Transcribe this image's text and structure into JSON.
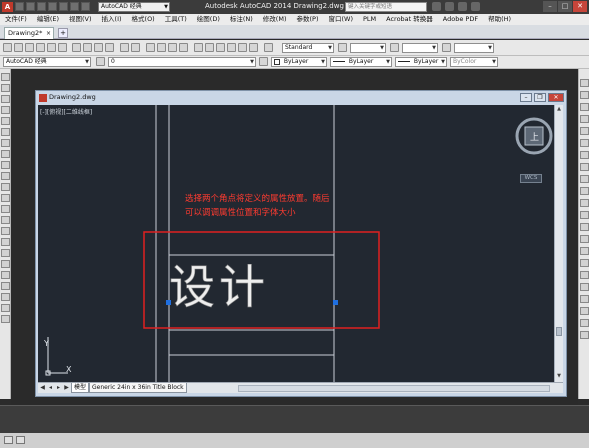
{
  "titlebar": {
    "app_title": "Autodesk AutoCAD 2014    Drawing2.dwg",
    "workspace_value": "AutoCAD 经典",
    "search_placeholder": "键入关键字或短语",
    "app_icon": "A"
  },
  "menubar": {
    "items": [
      "文件(F)",
      "编辑(E)",
      "视图(V)",
      "插入(I)",
      "格式(O)",
      "工具(T)",
      "绘图(D)",
      "标注(N)",
      "修改(M)",
      "参数(P)",
      "窗口(W)",
      "PLM",
      "Acrobat 转换器",
      "Adobe PDF",
      "帮助(H)"
    ]
  },
  "tabs": {
    "active_tab": "Drawing2*",
    "close_glyph": "×",
    "new_tab_glyph": "+"
  },
  "toolbar1": {
    "textstyle_value": "Standard"
  },
  "toolbar2": {
    "workspace_value": "AutoCAD 经典",
    "layer_value": "0",
    "color_value": "ByLayer",
    "linetype_value": "ByLayer",
    "lineweight_value": "ByLayer",
    "plotstyle_value": "ByColor"
  },
  "drawing_window": {
    "title": "Drawing2.dwg",
    "viewport_label": "[-][俯视][二维线框]",
    "wcs_label": "WCS",
    "viewcube_face": "上",
    "ucs_y": "Y",
    "ucs_x": "X"
  },
  "layout_tabs": {
    "model_tab": "模型",
    "layout_tab": "Generic 24in x 36in Title Block"
  },
  "annotation": {
    "line1": "选择两个角点将定义的属性放置。随后",
    "line2": "可以调调属性位置和字体大小"
  },
  "drawing": {
    "attribute_text": "设计"
  },
  "colors": {
    "viewport_bg": "#222831",
    "annotation_red": "#ff3b30",
    "grip_blue": "#1f6fe0",
    "title_block_lines": "#c9ced6"
  }
}
